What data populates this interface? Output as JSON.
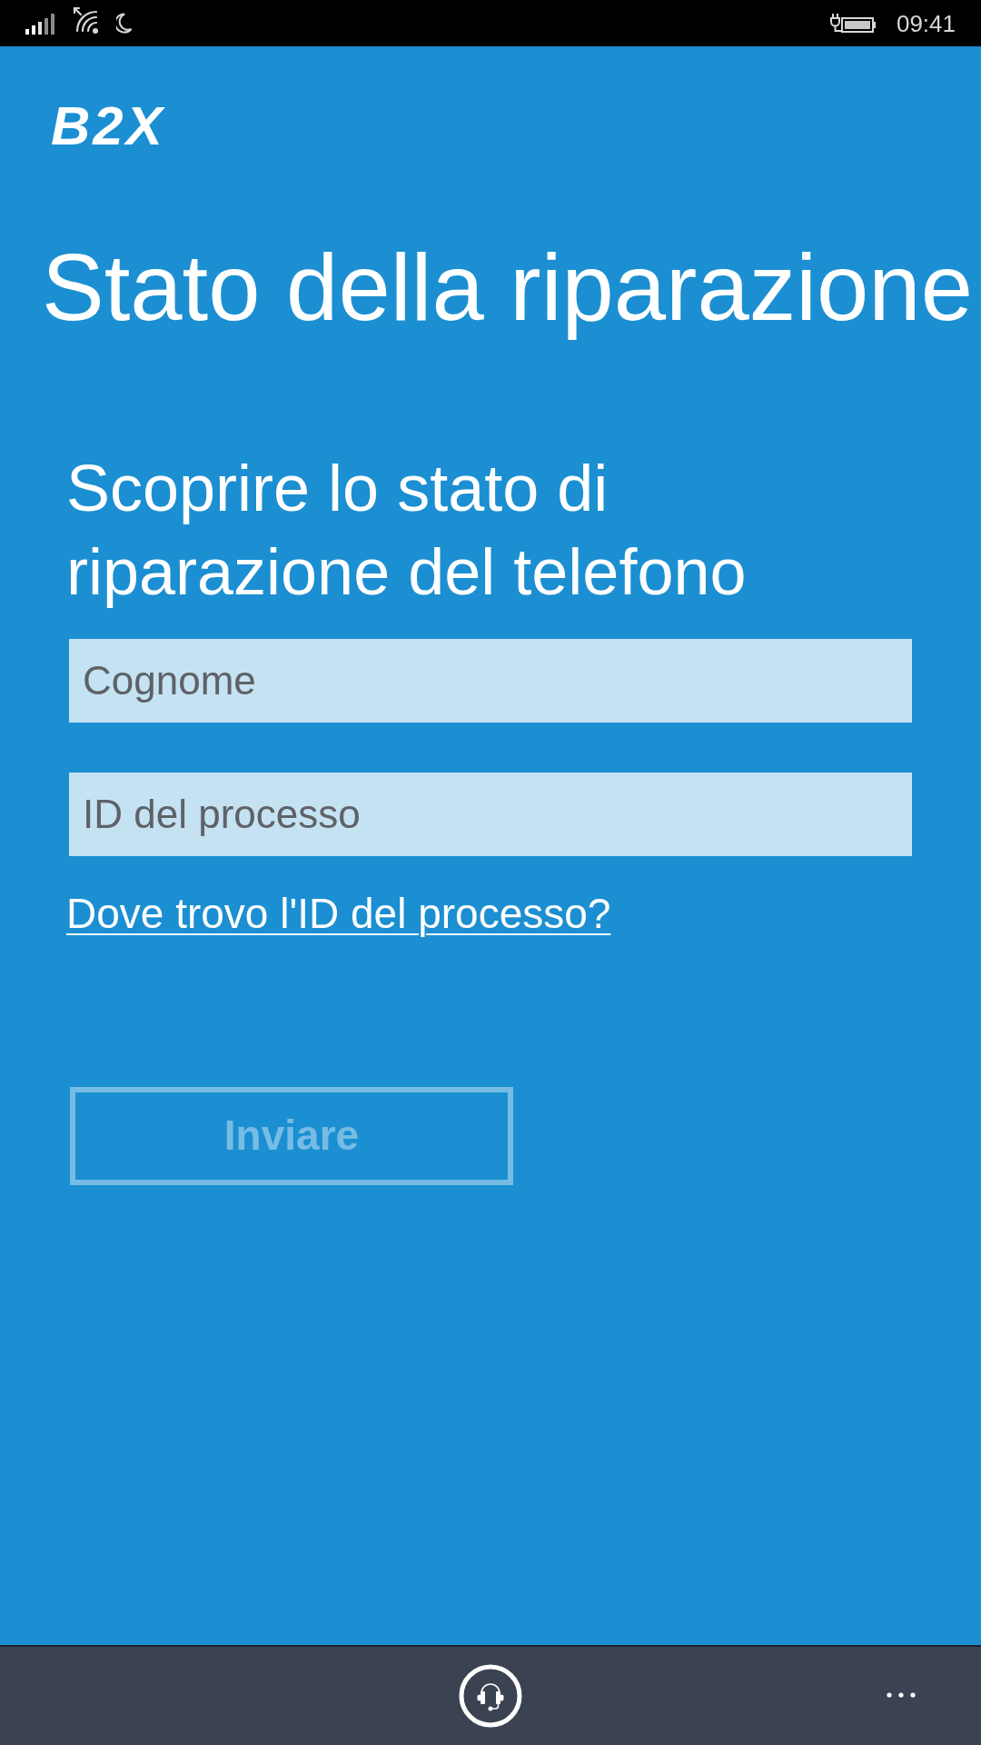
{
  "status_bar": {
    "time": "09:41"
  },
  "logo": "B2X",
  "title": "Stato della riparazione",
  "form": {
    "heading": "Scoprire lo stato di riparazione del telefono",
    "fields": [
      {
        "placeholder": "Cognome"
      },
      {
        "placeholder": "ID del processo"
      }
    ],
    "help_link": "Dove trovo l'ID del processo?",
    "submit": {
      "label": "Inviare",
      "disabled": true
    }
  }
}
